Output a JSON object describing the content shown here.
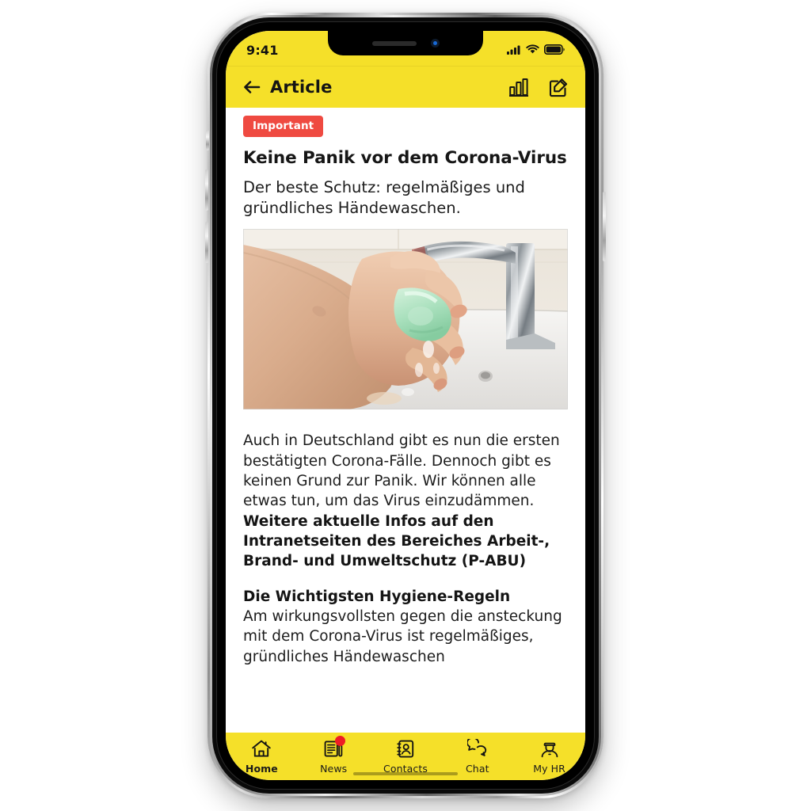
{
  "status_bar": {
    "time": "9:41",
    "icons": [
      "cellular-signal-icon",
      "wifi-icon",
      "battery-icon"
    ]
  },
  "nav_bar": {
    "back_icon": "arrow-left-icon",
    "title": "Article",
    "actions": [
      {
        "name": "statistics-icon",
        "label": "Statistics"
      },
      {
        "name": "compose-icon",
        "label": "Compose"
      }
    ]
  },
  "article": {
    "badge": "Important",
    "title": "Keine Panik vor dem Corona-Virus",
    "subtitle": "Der beste Schutz: regelmäßiges und gründliches Händewaschen.",
    "image_alt": "Hands being washed with soap under a running tap",
    "body": [
      {
        "bold": false,
        "text": "Auch in Deutschland gibt es nun die ersten bestätigten Corona-Fälle. Dennoch gibt es keinen Grund zur Panik. Wir können alle etwas tun, um das Virus einzudämmen."
      },
      {
        "bold": true,
        "text": "Weitere aktuelle Infos auf den Intranetseiten des Bereiches Arbeit-, Brand- und Umweltschutz (P-ABU)"
      },
      {
        "bold": true,
        "text": "Die Wichtigsten Hygiene-Regeln"
      },
      {
        "bold": false,
        "text": "Am wirkungsvollsten gegen die ansteckung mit dem Corona-Virus ist regelmäßiges, gründliches Händewaschen"
      }
    ]
  },
  "tab_bar": {
    "items": [
      {
        "label": "Home",
        "icon": "home-icon",
        "active": true,
        "badge": false
      },
      {
        "label": "News",
        "icon": "news-icon",
        "active": false,
        "badge": true
      },
      {
        "label": "Contacts",
        "icon": "contacts-icon",
        "active": false,
        "badge": false
      },
      {
        "label": "Chat",
        "icon": "chat-icon",
        "active": false,
        "badge": false
      },
      {
        "label": "My HR",
        "icon": "myhr-icon",
        "active": false,
        "badge": false
      }
    ]
  },
  "colors": {
    "brand_yellow": "#f5e029",
    "badge_red": "#ef4a41",
    "notification_red": "#ee1c25",
    "text_dark": "#1c1c1c"
  }
}
